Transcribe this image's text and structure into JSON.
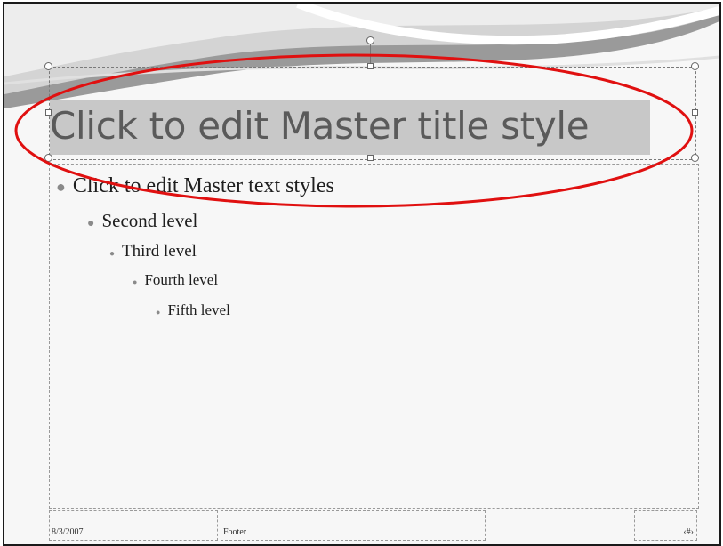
{
  "slide": {
    "title": "Click to edit Master title style",
    "body_levels": [
      "Click to edit Master text styles",
      "Second level",
      "Third level",
      "Fourth level",
      "Fifth level"
    ],
    "footer": {
      "date": "8/3/2007",
      "text": "Footer",
      "page_number": "‹#›"
    }
  },
  "colors": {
    "annotation_ellipse": "#e01010",
    "title_highlight": "#c8c8c8",
    "title_text": "#5a5a5a"
  }
}
